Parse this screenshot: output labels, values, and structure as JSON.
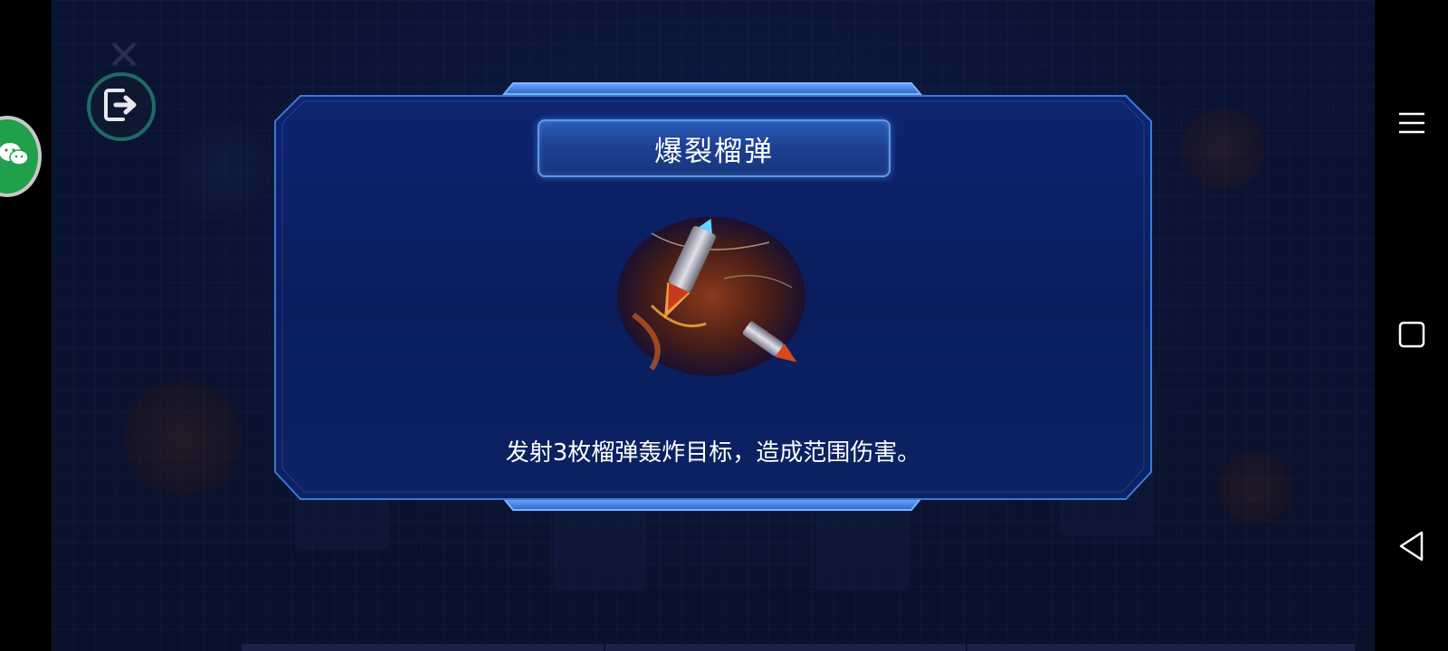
{
  "dialog": {
    "title": "爆裂榴弹",
    "description": "发射3枚榴弹轰炸目标，造成范围伤害。",
    "skill_icon": "grenade-missile-icon"
  },
  "floating": {
    "exit_icon": "exit-icon",
    "wechat_icon": "wechat-icon"
  },
  "nav_bar": {
    "menu_icon": "menu-icon",
    "home_icon": "square-home-icon",
    "back_icon": "back-triangle-icon"
  },
  "colors": {
    "background": "#0a1230",
    "panel": "#0a1e5a",
    "accent": "#4a8ae8",
    "wechat": "#20a04a"
  }
}
